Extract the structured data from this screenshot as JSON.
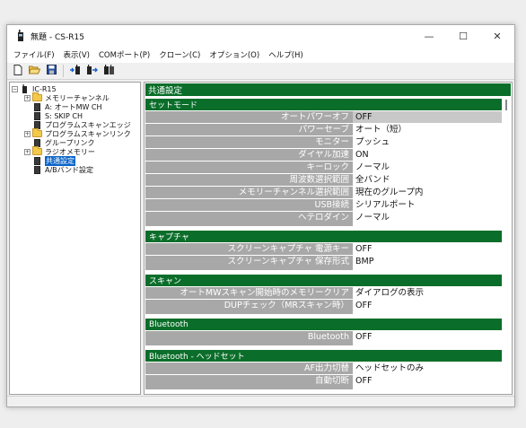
{
  "window": {
    "title": "無題 - CS-R15",
    "minimize": "—",
    "maximize": "☐",
    "close": "✕"
  },
  "menu": [
    "ファイル(F)",
    "表示(V)",
    "COMポート(P)",
    "クローン(C)",
    "オプション(O)",
    "ヘルプ(H)"
  ],
  "toolbar": {
    "icons": [
      "new-file-icon",
      "open-folder-icon",
      "save-icon",
      "read-from-radio-icon",
      "write-to-radio-icon",
      "transfer-icon"
    ]
  },
  "tree": {
    "root": "IC-R15",
    "items": [
      {
        "label": "メモリーチャンネル",
        "type": "folder",
        "expand": "+"
      },
      {
        "label": "A: オートMW CH",
        "type": "doc",
        "expand": ""
      },
      {
        "label": "S: SKIP CH",
        "type": "doc",
        "expand": ""
      },
      {
        "label": "プログラムスキャンエッジ",
        "type": "doc",
        "expand": ""
      },
      {
        "label": "プログラムスキャンリンク",
        "type": "folder",
        "expand": "+"
      },
      {
        "label": "グループリンク",
        "type": "doc",
        "expand": ""
      },
      {
        "label": "ラジオメモリー",
        "type": "folder",
        "expand": "+"
      },
      {
        "label": "共通設定",
        "type": "doc",
        "expand": "",
        "selected": true
      },
      {
        "label": "A/Bバンド設定",
        "type": "doc",
        "expand": ""
      }
    ]
  },
  "content": {
    "header": "共通設定",
    "sections": [
      {
        "title": "セットモード",
        "rows": [
          {
            "key": "オートパワーオフ",
            "value": "OFF",
            "selected": true
          },
          {
            "key": "パワーセーブ",
            "value": "オート（短）"
          },
          {
            "key": "モニター",
            "value": "プッシュ"
          },
          {
            "key": "ダイヤル加速",
            "value": "ON"
          },
          {
            "key": "キーロック",
            "value": "ノーマル"
          },
          {
            "key": "周波数選択範囲",
            "value": "全バンド"
          },
          {
            "key": "メモリーチャンネル選択範囲",
            "value": "現在のグループ内"
          },
          {
            "key": "USB接続",
            "value": "シリアルポート"
          },
          {
            "key": "ヘテロダイン",
            "value": "ノーマル"
          }
        ]
      },
      {
        "title": "キャプチャ",
        "rows": [
          {
            "key": "スクリーンキャプチャ 電源キー",
            "value": "OFF"
          },
          {
            "key": "スクリーンキャプチャ 保存形式",
            "value": "BMP"
          }
        ]
      },
      {
        "title": "スキャン",
        "rows": [
          {
            "key": "オートMWスキャン開始時のメモリークリア",
            "value": "ダイアログの表示"
          },
          {
            "key": "DUPチェック（MRスキャン時）",
            "value": "OFF"
          }
        ]
      },
      {
        "title": "Bluetooth",
        "rows": [
          {
            "key": "Bluetooth",
            "value": "OFF"
          }
        ]
      },
      {
        "title": "Bluetooth - ヘッドセット",
        "rows": [
          {
            "key": "AF出力切替",
            "value": "ヘッドセットのみ"
          },
          {
            "key": "自動切断",
            "value": "OFF"
          }
        ]
      }
    ]
  }
}
